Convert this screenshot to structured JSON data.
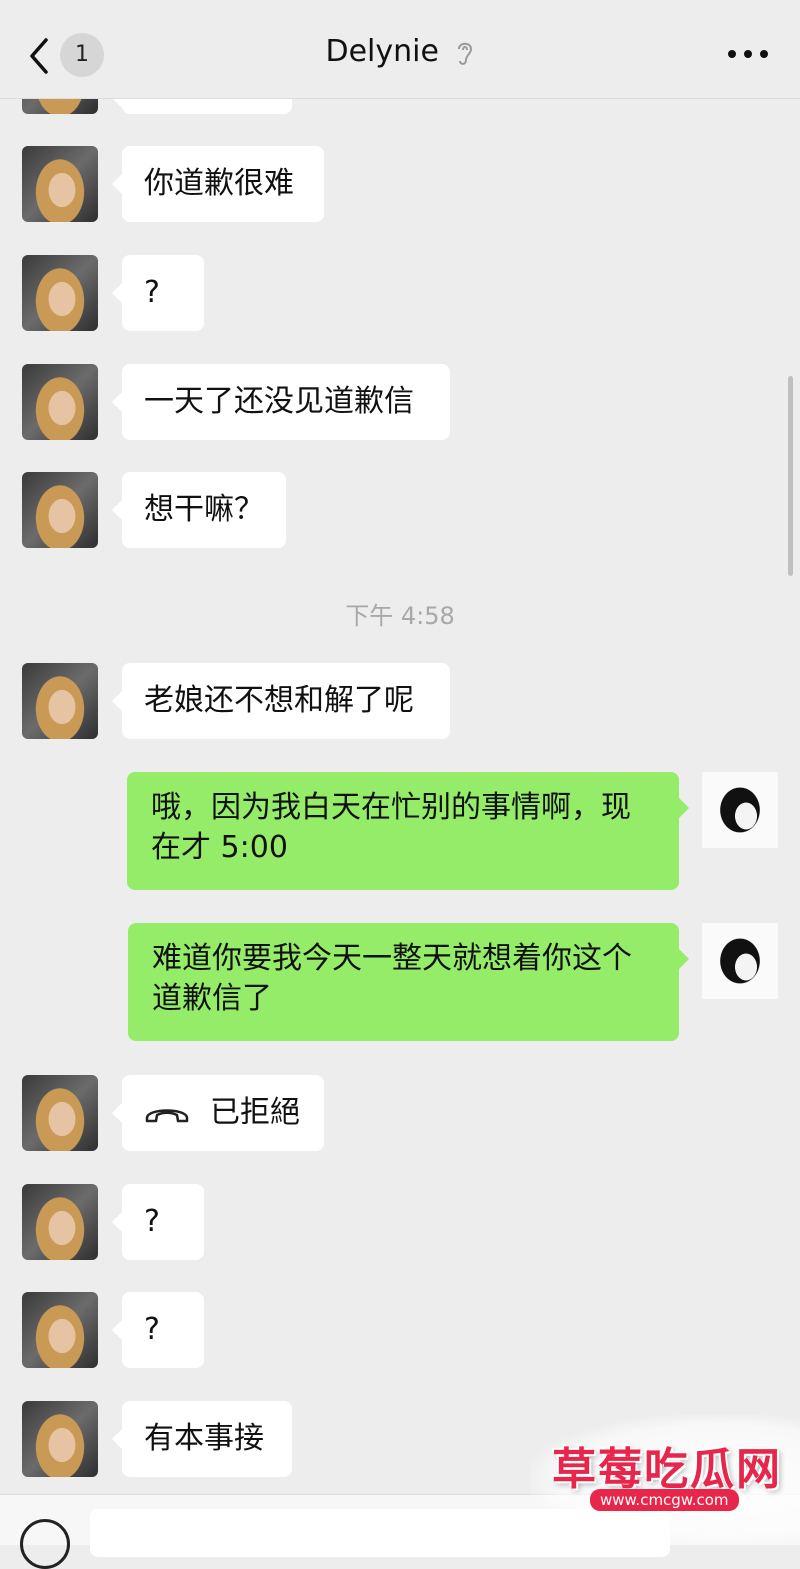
{
  "header": {
    "badge": "1",
    "title": "Delynie"
  },
  "messages": [
    {
      "text": "你道歉很难"
    },
    {
      "text": "?"
    },
    {
      "text": "一天了还没见道歉信"
    },
    {
      "text": "想干嘛？"
    },
    {
      "text": "老娘还不想和解了呢"
    },
    {
      "line1": "哦，因为我白天在忙别的事情啊，现",
      "line2": "在才 5:00"
    },
    {
      "line1": "难道你要我今天一整天就想着你这个",
      "line2": "道歉信了"
    },
    {
      "text": "已拒絕"
    },
    {
      "text": "?"
    },
    {
      "text": "?"
    },
    {
      "text": "有本事接"
    }
  ],
  "timestamp": "下午 4:58",
  "watermark": {
    "title": "草莓吃瓜网",
    "url": "www.cmcgw.com"
  },
  "colors": {
    "sent_bubble": "#95ec69",
    "received_bubble": "#ffffff",
    "background": "#ededed"
  }
}
